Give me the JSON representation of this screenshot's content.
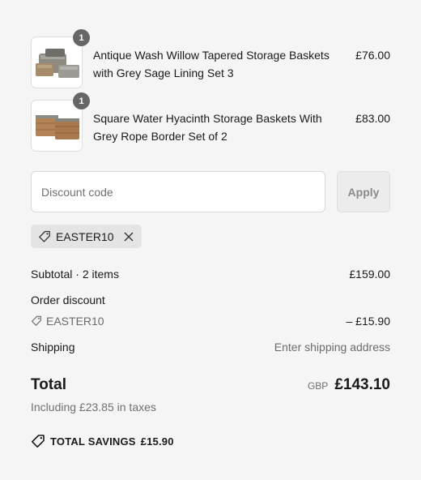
{
  "cart": {
    "items": [
      {
        "title": "Antique Wash Willow Tapered Storage Baskets with Grey Sage Lining Set 3",
        "price": "£76.00",
        "quantity": "1",
        "image_icon": "storage-basket-set-icon"
      },
      {
        "title": "Square Water Hyacinth Storage Baskets With Grey Rope Border Set of 2",
        "price": "£83.00",
        "quantity": "1",
        "image_icon": "storage-basket-set-icon"
      }
    ]
  },
  "discount": {
    "placeholder": "Discount code",
    "apply_label": "Apply",
    "applied_code": "EASTER10"
  },
  "summary": {
    "subtotal_label": "Subtotal · 2 items",
    "subtotal_value": "£159.00",
    "order_discount_label": "Order discount",
    "order_discount_code": "EASTER10",
    "order_discount_value": "– £15.90",
    "shipping_label": "Shipping",
    "shipping_value": "Enter shipping address",
    "total_label": "Total",
    "currency": "GBP",
    "total_value": "£143.10",
    "taxes_note": "Including £23.85 in taxes",
    "savings_label": "TOTAL SAVINGS",
    "savings_value": "£15.90"
  },
  "colors": {
    "background": "#f5f5f5",
    "badge": "#666666",
    "chip": "#e4e4e4"
  }
}
